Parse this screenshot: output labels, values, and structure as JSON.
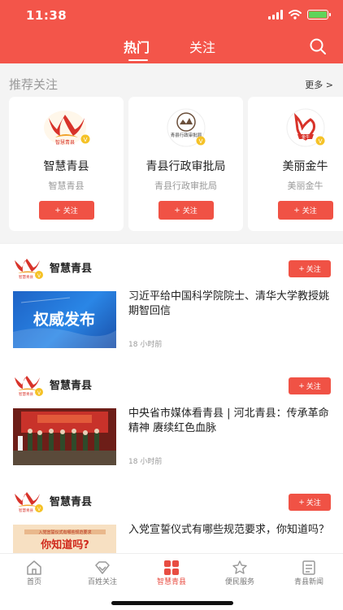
{
  "status_bar": {
    "time": "11:38"
  },
  "header": {
    "tabs": [
      {
        "label": "热门"
      },
      {
        "label": "关注"
      }
    ],
    "colors": {
      "brand": "#f3554a",
      "follow_button": "#f05245"
    }
  },
  "recommend": {
    "title": "推荐关注",
    "more": "更多 >",
    "cards": [
      {
        "name": "智慧青县",
        "sub": "智慧青县",
        "follow": "关注",
        "logo_text": "智慧青县"
      },
      {
        "name": "青县行政审批局",
        "sub": "青县行政审批局",
        "follow": "关注",
        "logo_text": "青县行政审批局"
      },
      {
        "name": "美丽金牛",
        "sub": "美丽金牛",
        "follow": "关注",
        "logo_text": "金牛"
      }
    ]
  },
  "feed": [
    {
      "source": "智慧青县",
      "follow": "关注",
      "title": "习近平给中国科学院院士、清华大学教授姚期智回信",
      "time": "18 小时前",
      "thumb_text": "权威发布"
    },
    {
      "source": "智慧青县",
      "follow": "关注",
      "title": "中央省市媒体看青县 | 河北青县：传承革命精神 赓续红色血脉",
      "time": "18 小时前",
      "thumb_text": ""
    },
    {
      "source": "智慧青县",
      "follow": "关注",
      "title": "入党宣誓仪式有哪些规范要求，你知道吗？",
      "time": "",
      "thumb_text": "你知道吗?",
      "thumb_caption": "入党宣誓仪式有哪些规范要求"
    }
  ],
  "bottom_nav": [
    {
      "label": "首页",
      "icon": "home-icon"
    },
    {
      "label": "百姓关注",
      "icon": "diamond-icon"
    },
    {
      "label": "智慧青县",
      "icon": "grid-icon",
      "active": true
    },
    {
      "label": "便民服务",
      "icon": "star-icon"
    },
    {
      "label": "青县新闻",
      "icon": "document-icon"
    }
  ]
}
